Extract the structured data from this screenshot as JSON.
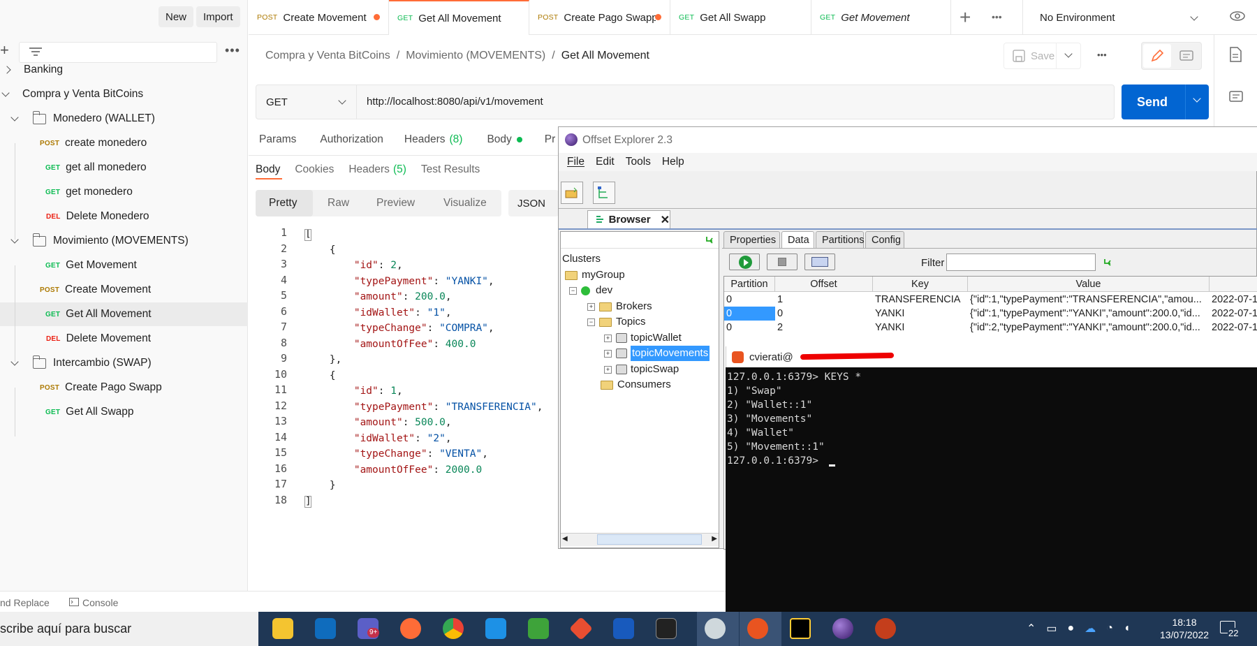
{
  "sidebar": {
    "new_label": "New",
    "import_label": "Import",
    "items": [
      {
        "type": "folder-collapsed",
        "label": "Banking"
      },
      {
        "type": "collection-open",
        "label": "Compra y Venta BitCoins"
      },
      {
        "type": "folder-open",
        "label": "Monedero (WALLET)"
      },
      {
        "method": "POST",
        "label": "create monedero"
      },
      {
        "method": "GET",
        "label": "get all monedero"
      },
      {
        "method": "GET",
        "label": "get monedero"
      },
      {
        "method": "DEL",
        "label": "Delete Monedero"
      },
      {
        "type": "folder-open",
        "label": "Movimiento (MOVEMENTS)"
      },
      {
        "method": "GET",
        "label": "Get Movement"
      },
      {
        "method": "POST",
        "label": "Create Movement"
      },
      {
        "method": "GET",
        "label": "Get All Movement",
        "selected": true
      },
      {
        "method": "DEL",
        "label": "Delete Movement"
      },
      {
        "type": "folder-open",
        "label": "Intercambio (SWAP)"
      },
      {
        "method": "POST",
        "label": "Create Pago Swapp"
      },
      {
        "method": "GET",
        "label": "Get All Swapp"
      }
    ],
    "find_replace": "nd Replace",
    "console": "Console"
  },
  "tabs": [
    {
      "method": "POST",
      "label": "Create Movement",
      "unsaved": true
    },
    {
      "method": "GET",
      "label": "Get All Movement",
      "active": true
    },
    {
      "method": "POST",
      "label": "Create Pago Swapp",
      "unsaved": true
    },
    {
      "method": "GET",
      "label": "Get All Swapp"
    },
    {
      "method": "GET",
      "label": "Get Movement",
      "italic": true
    }
  ],
  "environment": "No Environment",
  "breadcrumb": {
    "collection": "Compra y Venta BitCoins",
    "folder": "Movimiento (MOVEMENTS)",
    "request": "Get All Movement",
    "sep": "/"
  },
  "save_label": "Save",
  "request": {
    "method": "GET",
    "url": "http://localhost:8080/api/v1/movement",
    "send_label": "Send",
    "tabs": {
      "params": "Params",
      "authorization": "Authorization",
      "headers": "Headers",
      "headers_count": "(8)",
      "body": "Body",
      "pre": "Pr"
    }
  },
  "response": {
    "tabs": {
      "body": "Body",
      "cookies": "Cookies",
      "headers": "Headers",
      "headers_count": "(5)",
      "tests": "Test Results"
    },
    "views": {
      "pretty": "Pretty",
      "raw": "Raw",
      "preview": "Preview",
      "visualize": "Visualize"
    },
    "format": "JSON",
    "line_numbers": [
      "1",
      "2",
      "3",
      "4",
      "5",
      "6",
      "7",
      "8",
      "9",
      "10",
      "11",
      "12",
      "13",
      "14",
      "15",
      "16",
      "17",
      "18"
    ],
    "lines": [
      [
        {
          "t": "pun",
          "v": "["
        }
      ],
      [
        {
          "t": "pun",
          "v": "    {"
        }
      ],
      [
        {
          "t": "key",
          "v": "        \"id\""
        },
        {
          "t": "pun",
          "v": ": "
        },
        {
          "t": "num",
          "v": "2"
        },
        {
          "t": "pun",
          "v": ","
        }
      ],
      [
        {
          "t": "key",
          "v": "        \"typePayment\""
        },
        {
          "t": "pun",
          "v": ": "
        },
        {
          "t": "str",
          "v": "\"YANKI\""
        },
        {
          "t": "pun",
          "v": ","
        }
      ],
      [
        {
          "t": "key",
          "v": "        \"amount\""
        },
        {
          "t": "pun",
          "v": ": "
        },
        {
          "t": "num",
          "v": "200.0"
        },
        {
          "t": "pun",
          "v": ","
        }
      ],
      [
        {
          "t": "key",
          "v": "        \"idWallet\""
        },
        {
          "t": "pun",
          "v": ": "
        },
        {
          "t": "str",
          "v": "\"1\""
        },
        {
          "t": "pun",
          "v": ","
        }
      ],
      [
        {
          "t": "key",
          "v": "        \"typeChange\""
        },
        {
          "t": "pun",
          "v": ": "
        },
        {
          "t": "str",
          "v": "\"COMPRA\""
        },
        {
          "t": "pun",
          "v": ","
        }
      ],
      [
        {
          "t": "key",
          "v": "        \"amountOfFee\""
        },
        {
          "t": "pun",
          "v": ": "
        },
        {
          "t": "num",
          "v": "400.0"
        }
      ],
      [
        {
          "t": "pun",
          "v": "    },"
        }
      ],
      [
        {
          "t": "pun",
          "v": "    {"
        }
      ],
      [
        {
          "t": "key",
          "v": "        \"id\""
        },
        {
          "t": "pun",
          "v": ": "
        },
        {
          "t": "num",
          "v": "1"
        },
        {
          "t": "pun",
          "v": ","
        }
      ],
      [
        {
          "t": "key",
          "v": "        \"typePayment\""
        },
        {
          "t": "pun",
          "v": ": "
        },
        {
          "t": "str",
          "v": "\"TRANSFERENCIA\""
        },
        {
          "t": "pun",
          "v": ","
        }
      ],
      [
        {
          "t": "key",
          "v": "        \"amount\""
        },
        {
          "t": "pun",
          "v": ": "
        },
        {
          "t": "num",
          "v": "500.0"
        },
        {
          "t": "pun",
          "v": ","
        }
      ],
      [
        {
          "t": "key",
          "v": "        \"idWallet\""
        },
        {
          "t": "pun",
          "v": ": "
        },
        {
          "t": "str",
          "v": "\"2\""
        },
        {
          "t": "pun",
          "v": ","
        }
      ],
      [
        {
          "t": "key",
          "v": "        \"typeChange\""
        },
        {
          "t": "pun",
          "v": ": "
        },
        {
          "t": "str",
          "v": "\"VENTA\""
        },
        {
          "t": "pun",
          "v": ","
        }
      ],
      [
        {
          "t": "key",
          "v": "        \"amountOfFee\""
        },
        {
          "t": "pun",
          "v": ": "
        },
        {
          "t": "num",
          "v": "2000.0"
        }
      ],
      [
        {
          "t": "pun",
          "v": "    }"
        }
      ],
      [
        {
          "t": "pun",
          "v": "]"
        }
      ]
    ]
  },
  "offset_explorer": {
    "title": "Offset Explorer  2.3",
    "menu": [
      "File",
      "Edit",
      "Tools",
      "Help"
    ],
    "browser_tab": "Browser",
    "tree": {
      "clusters": "Clusters",
      "group": "myGroup",
      "dev": "dev",
      "brokers": "Brokers",
      "topics": "Topics",
      "topic_items": [
        "topicWallet",
        "topicMovements",
        "topicSwap"
      ],
      "consumers": "Consumers"
    },
    "data_tabs": [
      "Properties",
      "Data",
      "Partitions",
      "Config"
    ],
    "filter_label": "Filter",
    "columns": [
      "Partition",
      "Offset",
      "Key",
      "Value"
    ],
    "rows": [
      [
        "0",
        "1",
        "TRANSFERENCIA",
        "{\"id\":1,\"typePayment\":\"TRANSFERENCIA\",\"amou...",
        "2022-07-1"
      ],
      [
        "0",
        "0",
        "YANKI",
        "{\"id\":1,\"typePayment\":\"YANKI\",\"amount\":200.0,\"id...",
        "2022-07-1"
      ],
      [
        "0",
        "2",
        "YANKI",
        "{\"id\":2,\"typePayment\":\"YANKI\",\"amount\":200.0,\"id...",
        "2022-07-1"
      ]
    ]
  },
  "terminal": {
    "title": "cvierati@",
    "lines": [
      "127.0.0.1:6379> KEYS *",
      "1) \"Swap\"",
      "2) \"Wallet::1\"",
      "3) \"Movements\"",
      "4) \"Wallet\"",
      "5) \"Movement::1\"",
      "127.0.0.1:6379> "
    ]
  },
  "taskbar": {
    "search_placeholder": "scribe aquí para buscar",
    "teams_badge": "9+",
    "time": "18:18",
    "date": "13/07/2022",
    "notifications": "22"
  }
}
